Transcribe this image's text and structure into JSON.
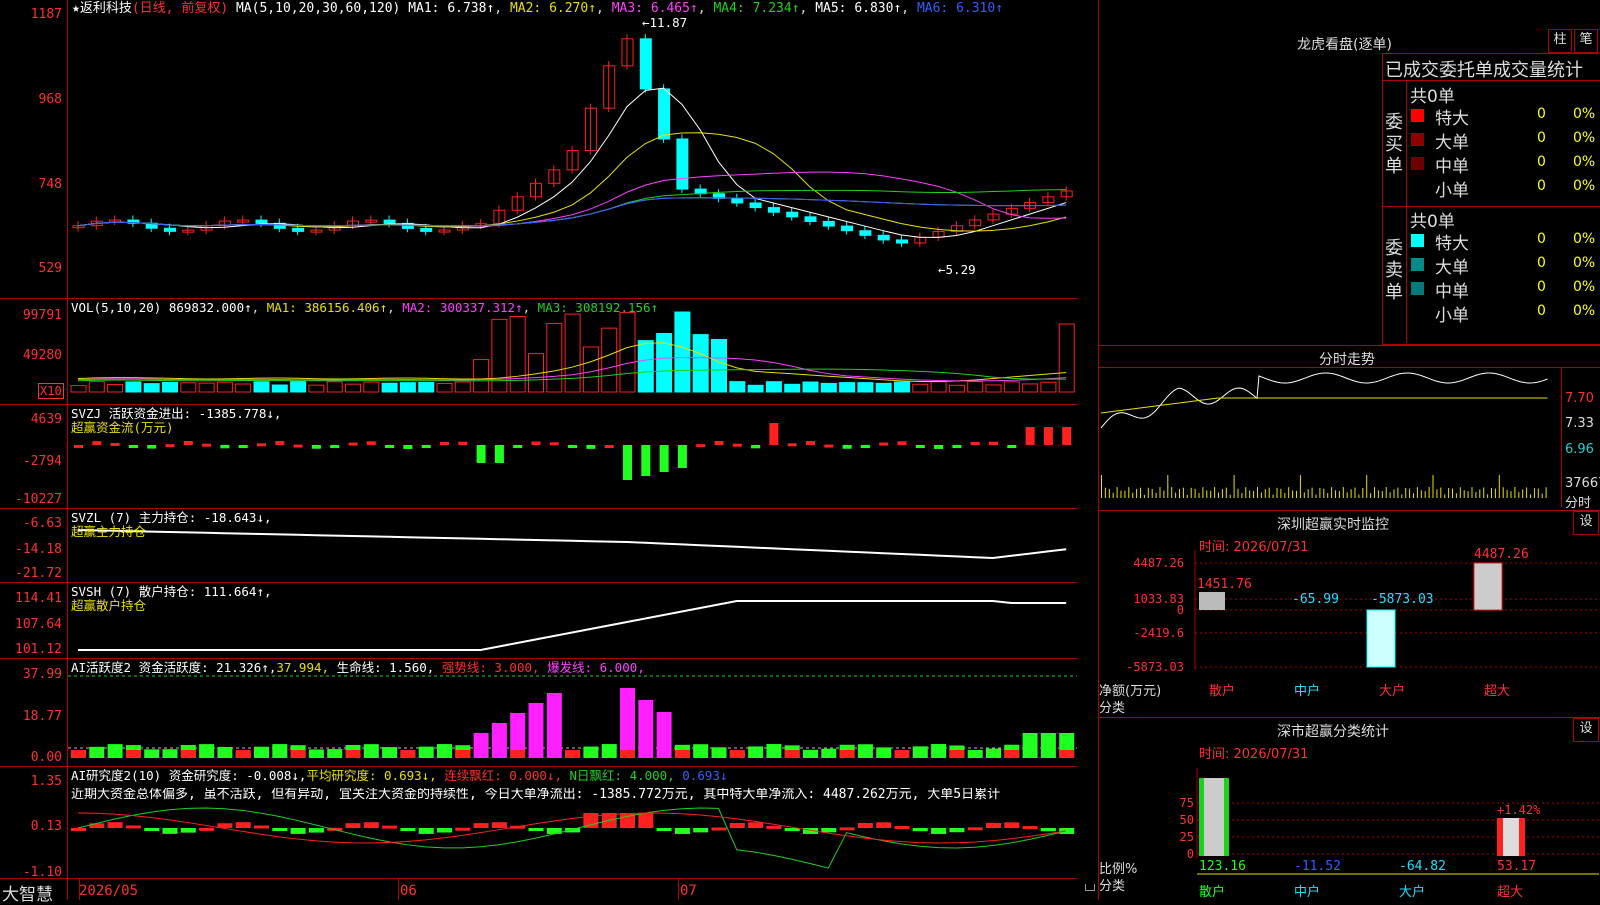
{
  "header": {
    "star_icon": "star-icon",
    "stock_name": "返利科技",
    "kline_mode": "(日线, 前复权)",
    "ma_params": "MA(5,10,20,30,60,120)",
    "ma1": "MA1: 6.738↑",
    "ma2": "MA2: 6.270↑",
    "ma3": "MA3: 6.465↑",
    "ma4": "MA4: 7.234↑",
    "ma5": "MA5: 6.830↑",
    "ma6": "MA6: 6.310↑"
  },
  "price_axis": [
    "1187",
    "968",
    "748",
    "529"
  ],
  "price_annotations": {
    "high": "11.87",
    "low": "5.29"
  },
  "vol": {
    "title": "VOL(5,10,20)",
    "value": "869832.000↑",
    "ma1": "MA1: 386156.406↑",
    "ma2": "MA2: 300337.312↑",
    "ma3": "MA3: 308192.156↑",
    "axis": [
      "99791",
      "49280"
    ],
    "unit_badge": "X10"
  },
  "svzj": {
    "title": "SVZJ  活跃资金进出: -1385.778↓,",
    "subtitle": "超赢资金流(万元)",
    "axis": [
      "4639",
      "-2794",
      "-10227"
    ]
  },
  "svzl": {
    "title": "SVZL (7) 主力持仓: -18.643↓,",
    "subtitle": "超赢主力持仓",
    "axis": [
      "-6.63",
      "-14.18",
      "-21.72"
    ]
  },
  "svsh": {
    "title": "SVSH (7) 散户持仓: 111.664↑,",
    "subtitle": "超赢散户持仓",
    "axis": [
      "114.41",
      "107.64",
      "101.12"
    ]
  },
  "ai_active": {
    "title_a": "AI活跃度2 资金活跃度: 21.326↑,",
    "title_b": "37.994,",
    "title_c": "生命线: 1.560,",
    "title_d": "强势线: 3.000,",
    "title_e": "爆发线: 6.000,",
    "axis": [
      "37.99",
      "18.77",
      "0.00"
    ]
  },
  "ai_research": {
    "title_a": "AI研究度2(10) 资金研究度: -0.008↓,",
    "title_b": "平均研究度: 0.693↓,",
    "title_c": "连续飘红: 0.000↓,",
    "title_d": "N日飘红: 4.000,",
    "title_e": "0.693↓",
    "comment": "近期大资金总体偏多, 虽不活跃, 但有异动, 宜关注大资金的持续性, 今日大单净流出: -1385.772万元, 其中特大单净流入: 4487.262万元, 大单5日累计",
    "axis": [
      "1.35",
      "0.13",
      "-1.10"
    ]
  },
  "bottom_bar": {
    "brand": "大智慧",
    "dates": [
      "2026/05",
      "06",
      "07"
    ]
  },
  "right": {
    "top_title": "龙虎看盘(逐单)",
    "btn_zhu": "柱",
    "btn_bi": "笔",
    "stats_title": "已成交委托单成交量统计",
    "buy_label": "委买单",
    "sell_label": "委卖单",
    "buy_total": "共0单",
    "sell_total": "共0单",
    "buy_rows": [
      {
        "name": "特大",
        "count": "0",
        "pct": "0%",
        "color": "#ff0000"
      },
      {
        "name": "大单",
        "count": "0",
        "pct": "0%",
        "color": "#900000"
      },
      {
        "name": "中单",
        "count": "0",
        "pct": "0%",
        "color": "#700000"
      },
      {
        "name": "小单",
        "count": "0",
        "pct": "0%",
        "color": ""
      }
    ],
    "sell_rows": [
      {
        "name": "特大",
        "count": "0",
        "pct": "0%",
        "color": "#00ffff"
      },
      {
        "name": "大单",
        "count": "0",
        "pct": "0%",
        "color": "#008b8b"
      },
      {
        "name": "中单",
        "count": "0",
        "pct": "0%",
        "color": "#007a7a"
      },
      {
        "name": "小单",
        "count": "0",
        "pct": "0%",
        "color": ""
      }
    ],
    "fenshi_title": "分时走势",
    "fenshi_axis": [
      "7.70",
      "7.33",
      "6.96"
    ],
    "fenshi_vol": "37667",
    "fenshi_unit": "分时",
    "sz_monitor_title": "深圳超赢实时监控",
    "sz_monitor_btn": "设",
    "monitor_time": "时间: 2026/07/31",
    "monitor_axis": [
      "4487.26",
      "1033.83",
      "0",
      "-2419.6",
      "-5873.03"
    ],
    "monitor_values": {
      "sanhu": "1451.76",
      "zhonghu": "-65.99",
      "dahu": "-5873.03",
      "chaoda": "4487.26"
    },
    "monitor_ylabel": "净额(万元)",
    "monitor_xlabel": "分类",
    "categories": [
      "散户",
      "中户",
      "大户",
      "超大"
    ],
    "sz_class_title": "深市超赢分类统计",
    "sz_class_btn": "设",
    "class_time": "时间: 2026/07/31",
    "class_axis": [
      "75",
      "50",
      "25",
      "0"
    ],
    "class_pct_label": "+1.42%",
    "class_values": [
      "123.16",
      "-11.52",
      "-64.82",
      "53.17"
    ],
    "class_ylabel": "比例%",
    "class_xlabel": "分类"
  },
  "colors": {
    "up": "#ff2020",
    "down": "#00ffff",
    "grid": "#b00000",
    "ma1": "#ffffff",
    "ma2": "#e8e000",
    "ma3": "#ff40ff",
    "ma4": "#20d020",
    "ma5": "#b0b0b0",
    "ma6": "#3060ff"
  }
}
